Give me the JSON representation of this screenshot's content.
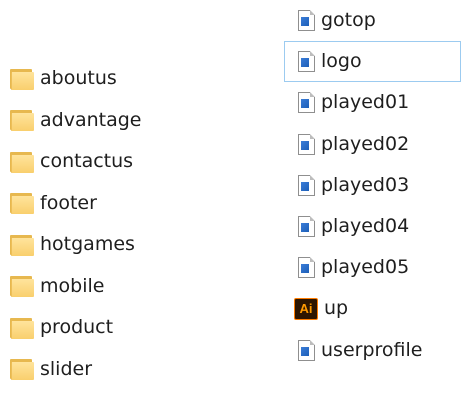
{
  "folders": [
    {
      "name": "aboutus",
      "icon": "folder-icon"
    },
    {
      "name": "advantage",
      "icon": "folder-icon"
    },
    {
      "name": "contactus",
      "icon": "folder-icon"
    },
    {
      "name": "footer",
      "icon": "folder-icon"
    },
    {
      "name": "hotgames",
      "icon": "folder-icon"
    },
    {
      "name": "mobile",
      "icon": "folder-icon"
    },
    {
      "name": "product",
      "icon": "folder-icon"
    },
    {
      "name": "slider",
      "icon": "folder-icon"
    }
  ],
  "files": [
    {
      "name": "gotop",
      "icon": "image-file-icon"
    },
    {
      "name": "logo",
      "icon": "image-file-icon",
      "focused": true
    },
    {
      "name": "played01",
      "icon": "image-file-icon"
    },
    {
      "name": "played02",
      "icon": "image-file-icon"
    },
    {
      "name": "played03",
      "icon": "image-file-icon"
    },
    {
      "name": "played04",
      "icon": "image-file-icon"
    },
    {
      "name": "played05",
      "icon": "image-file-icon"
    },
    {
      "name": "up",
      "icon": "illustrator-file-icon",
      "badge": "Ai"
    },
    {
      "name": "userprofile",
      "icon": "image-file-icon"
    }
  ],
  "colors": {
    "focus_border": "#9ccbf0",
    "folder": "#f9cf6d",
    "ai_badge_bg": "#2e1600",
    "ai_badge_fg": "#ff9a00"
  }
}
